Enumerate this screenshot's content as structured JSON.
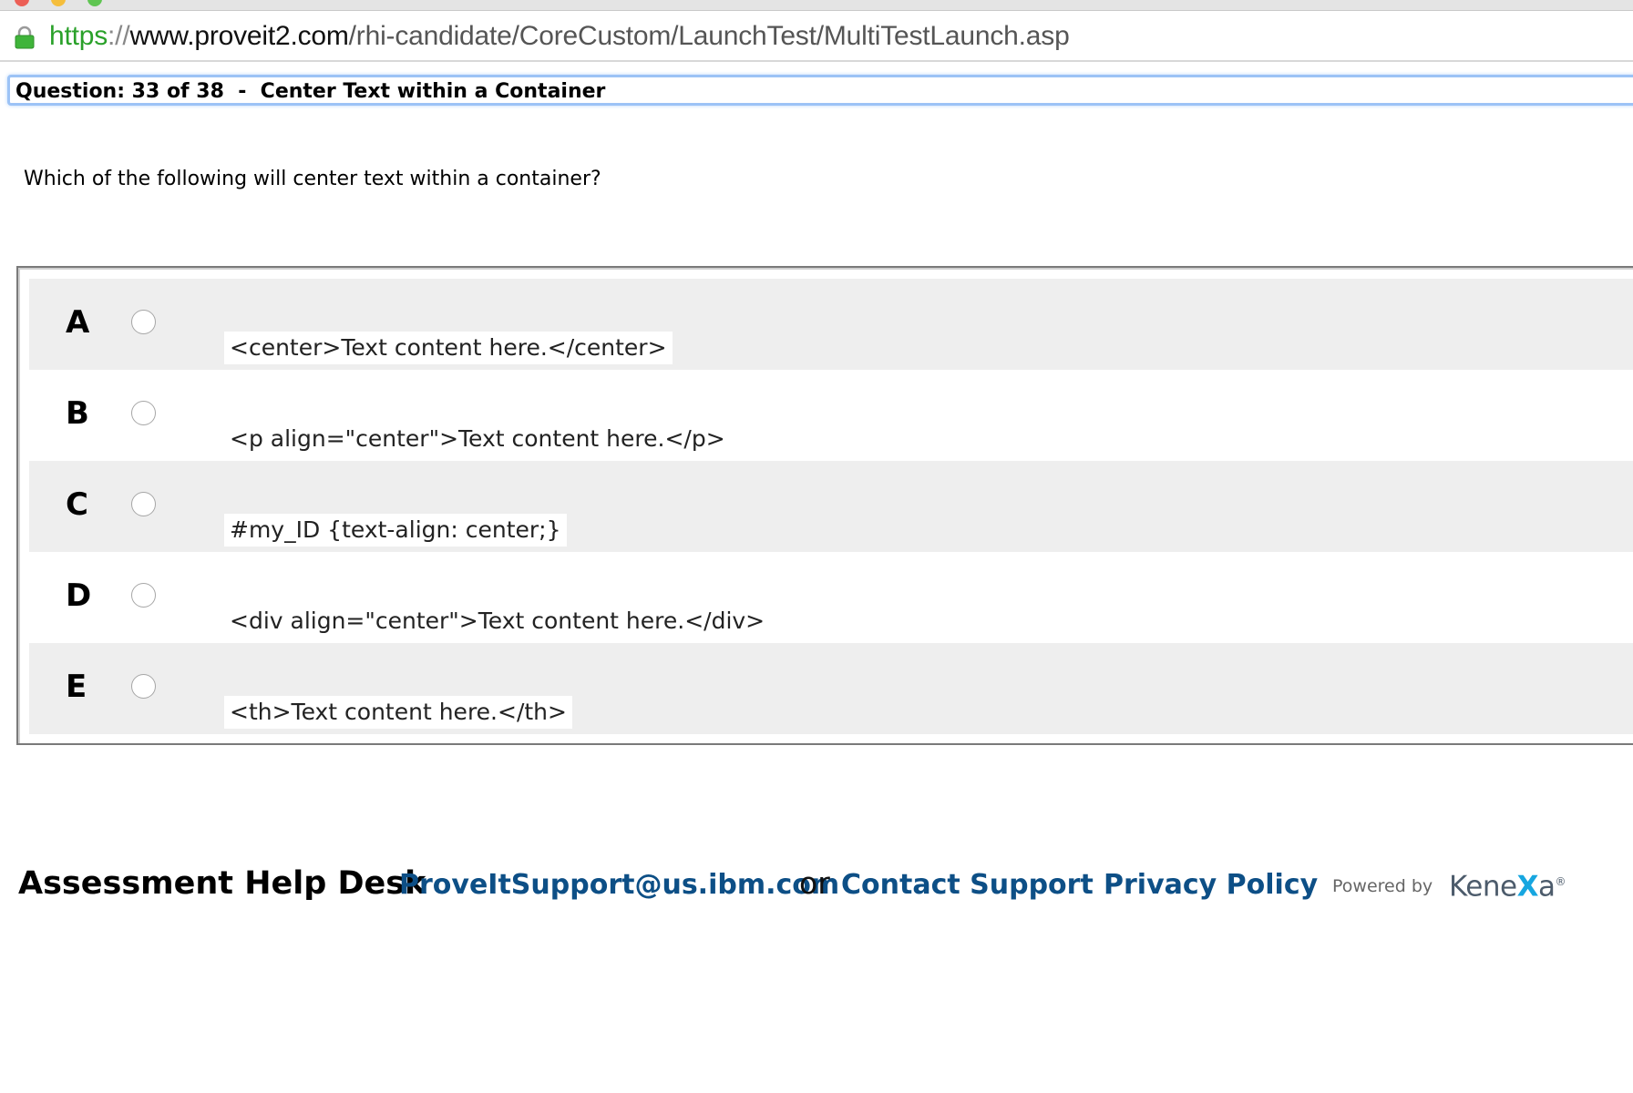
{
  "browser": {
    "url_scheme": "https",
    "url_separator": "://",
    "url_host": "www.proveit2.com",
    "url_path": "/rhi-candidate/CoreCustom/LaunchTest/MultiTestLaunch.asp"
  },
  "question": {
    "header": "Question: 33 of 38  -  Center Text within a Container",
    "prompt": "Which of the following will center text within a container?"
  },
  "answers": [
    {
      "letter": "A",
      "code": "<center>Text content here.</center>"
    },
    {
      "letter": "B",
      "code": "<p align=\"center\">Text content here.</p>"
    },
    {
      "letter": "C",
      "code": "#my_ID {text-align: center;}"
    },
    {
      "letter": "D",
      "code": "<div align=\"center\">Text content here.</div>"
    },
    {
      "letter": "E",
      "code": "<th>Text content here.</th>"
    }
  ],
  "footer": {
    "title": "Assessment Help Desk",
    "email": "ProveItSupport@us.ibm.com",
    "or": "or",
    "contact": "Contact Support",
    "privacy": "Privacy Policy",
    "powered_by": "Powered by",
    "brand_pre": "Kene",
    "brand_x": "X",
    "brand_post": "a"
  }
}
